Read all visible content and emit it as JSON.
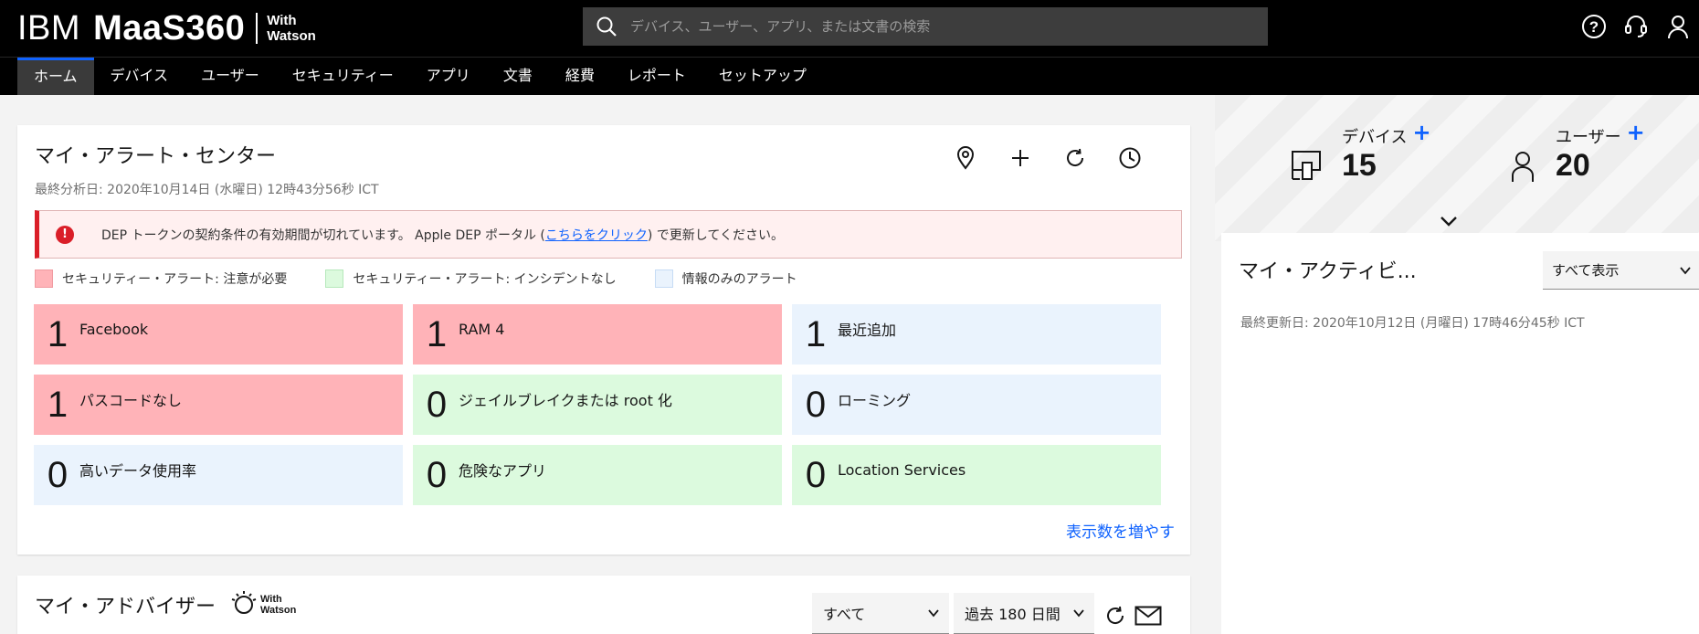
{
  "header": {
    "brand_ibm": "IBM",
    "brand_product": "MaaS360",
    "brand_with": "With",
    "brand_watson": "Watson",
    "search_placeholder": "デバイス、ユーザー、アプリ、または文書の検索",
    "icons": [
      "help-icon",
      "support-headset-icon",
      "user-profile-icon"
    ]
  },
  "nav": {
    "tabs": [
      {
        "label": "ホーム",
        "active": true
      },
      {
        "label": "デバイス"
      },
      {
        "label": "ユーザー"
      },
      {
        "label": "セキュリティー"
      },
      {
        "label": "アプリ"
      },
      {
        "label": "文書"
      },
      {
        "label": "経費"
      },
      {
        "label": "レポート"
      },
      {
        "label": "セットアップ"
      }
    ]
  },
  "alerts": {
    "title": "マイ・アラート・センター",
    "subtitle": "最終分析日: 2020年10月14日 (水曜日) 12時43分56秒 ICT",
    "actions": [
      "location-pin-icon",
      "add-icon",
      "refresh-icon",
      "history-clock-icon"
    ],
    "banner": {
      "text_before": "DEP トークンの契約条件の有効期間が切れています。 Apple DEP ポータル (",
      "link": "こちらをクリック",
      "text_after": ") で更新してください。"
    },
    "legend": [
      {
        "label": "セキュリティー・アラート: 注意が必要",
        "color": "#ffb3b8"
      },
      {
        "label": "セキュリティー・アラート: インシデントなし",
        "color": "#dcfade"
      },
      {
        "label": "情報のみのアラート",
        "color": "#eaf3fd"
      }
    ],
    "tiles": [
      {
        "count": "1",
        "label": "Facebook",
        "kind": "red"
      },
      {
        "count": "1",
        "label": "RAM 4",
        "kind": "red"
      },
      {
        "count": "1",
        "label": "最近追加",
        "kind": "blue"
      },
      {
        "count": "1",
        "label": "パスコードなし",
        "kind": "red"
      },
      {
        "count": "0",
        "label": "ジェイルブレイクまたは root 化",
        "kind": "green"
      },
      {
        "count": "0",
        "label": "ローミング",
        "kind": "blue"
      },
      {
        "count": "0",
        "label": "高いデータ使用率",
        "kind": "blue"
      },
      {
        "count": "0",
        "label": "危険なアプリ",
        "kind": "green"
      },
      {
        "count": "0",
        "label": "Location Services",
        "kind": "green"
      }
    ],
    "more_link": "表示数を増やす"
  },
  "advisor": {
    "title": "マイ・アドバイザー",
    "with": "With",
    "watson": "Watson",
    "filter_value": "すべて",
    "range_value": "過去 180 日間",
    "actions": [
      "refresh-icon",
      "mail-icon"
    ]
  },
  "stats": {
    "devices_label": "デバイス",
    "devices_value": "15",
    "users_label": "ユーザー",
    "users_value": "20",
    "plus": "+"
  },
  "activity": {
    "title": "マイ・アクティビ...",
    "filter_value": "すべて表示",
    "subtitle": "最終更新日: 2020年10月12日 (月曜日) 17時46分45秒 ICT"
  }
}
